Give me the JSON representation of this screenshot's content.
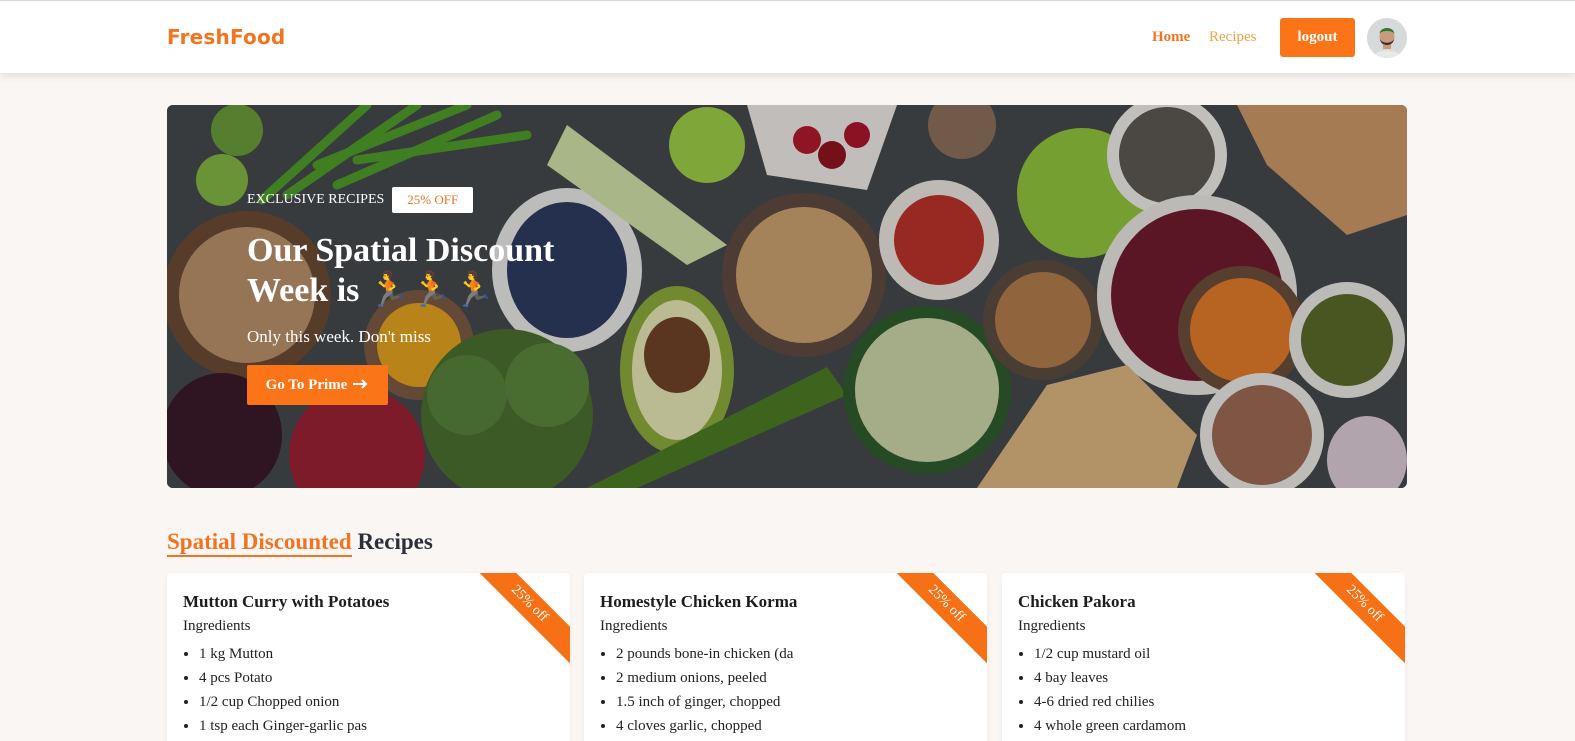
{
  "app": {
    "logo": "FreshFood"
  },
  "nav": {
    "home": "Home",
    "recipes": "Recipes",
    "logout": "logout"
  },
  "hero": {
    "eyebrow": "EXCLUSIVE RECIPES",
    "badge": "25% OFF",
    "title": "Our Spatial Discount Week is 🏃🏃🏃",
    "subtitle": "Only this week. Don't miss",
    "cta": "Go To Prime",
    "cta_icon": "arrow-right-icon"
  },
  "section": {
    "title_accent": "Spatial Discounted",
    "title_rest": "Recipes"
  },
  "cards": [
    {
      "title": "Mutton Curry with Potatoes",
      "subtitle": "Ingredients",
      "ribbon": "25% off",
      "ingredients": [
        "1 kg Mutton",
        "4 pcs Potato",
        "1/2 cup Chopped onion",
        "1 tsp each Ginger-garlic pas"
      ]
    },
    {
      "title": "Homestyle Chicken Korma",
      "subtitle": "Ingredients",
      "ribbon": "25% off",
      "ingredients": [
        "2 pounds bone-in chicken (da",
        "2 medium onions, peeled",
        "1.5 inch of ginger, chopped",
        "4 cloves garlic, chopped"
      ]
    },
    {
      "title": "Chicken Pakora",
      "subtitle": "Ingredients",
      "ribbon": "25% off",
      "ingredients": [
        "1/2 cup mustard oil",
        "4 bay leaves",
        "4-6 dried red chilies",
        "4 whole green cardamom"
      ]
    }
  ],
  "colors": {
    "accent": "#fb7417",
    "background": "#faf6f3",
    "heading": "#2b2f3a"
  }
}
